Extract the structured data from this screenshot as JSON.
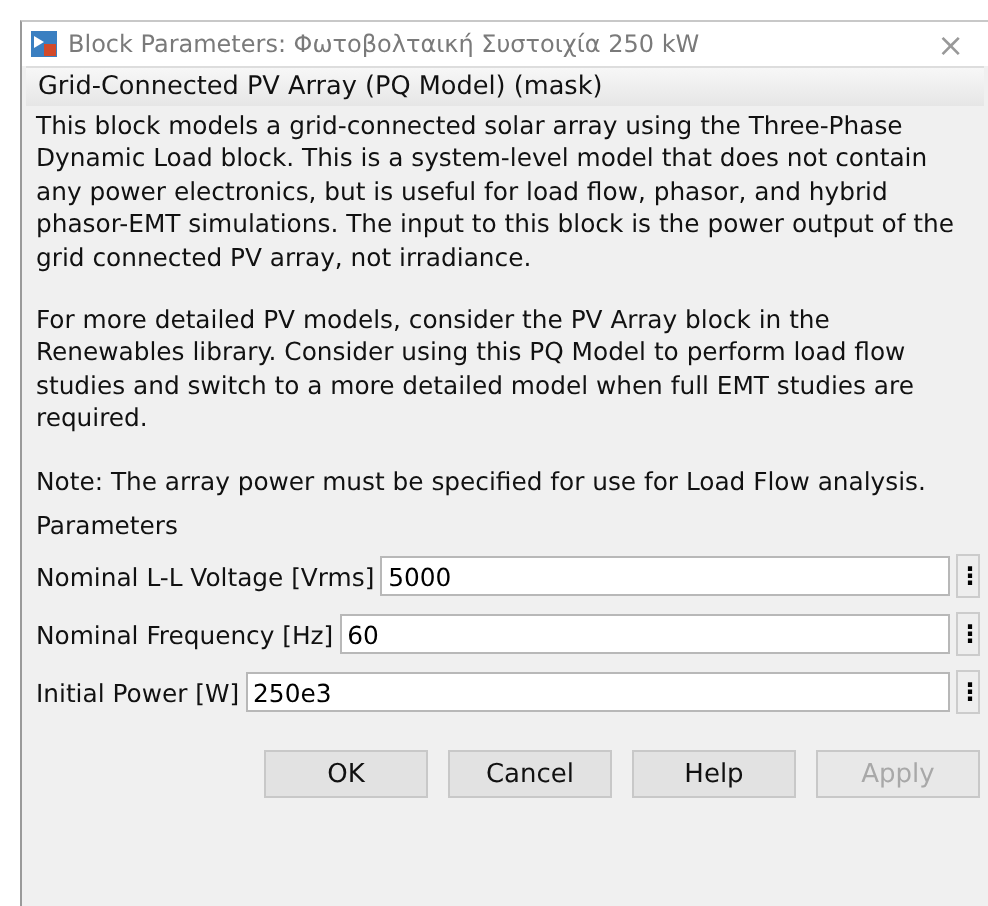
{
  "window": {
    "title": "Block Parameters: Φωτοβολταική Συστοιχία 250 kW",
    "close": "×"
  },
  "mask_title": "Grid-Connected PV Array (PQ Model) (mask)",
  "description": [
    "This block models a grid-connected solar array using the Three-Phase Dynamic Load block. This is a system-level model that does not contain any power electronics, but is useful for load flow, phasor, and hybrid phasor-EMT simulations. The input to this block is the power output of the grid connected PV array, not irradiance.",
    "For more detailed PV models, consider the PV Array block in the Renewables library. Consider using this PQ Model to perform load flow studies and switch to a more detailed model when full EMT studies are required.",
    "Note: The array power must be specified for use for Load Flow analysis."
  ],
  "parameters": {
    "title": "Parameters",
    "fields": [
      {
        "label": "Nominal L-L Voltage [Vrms]",
        "value": "5000",
        "menu": "⋮"
      },
      {
        "label": "Nominal Frequency [Hz]",
        "value": "60",
        "menu": "⋮"
      },
      {
        "label": "Initial Power [W]",
        "value": "250e3",
        "menu": "⋮"
      }
    ]
  },
  "buttons": [
    {
      "label": "OK",
      "disabled": false
    },
    {
      "label": "Cancel",
      "disabled": false
    },
    {
      "label": "Help",
      "disabled": false
    },
    {
      "label": "Apply",
      "disabled": true
    }
  ]
}
